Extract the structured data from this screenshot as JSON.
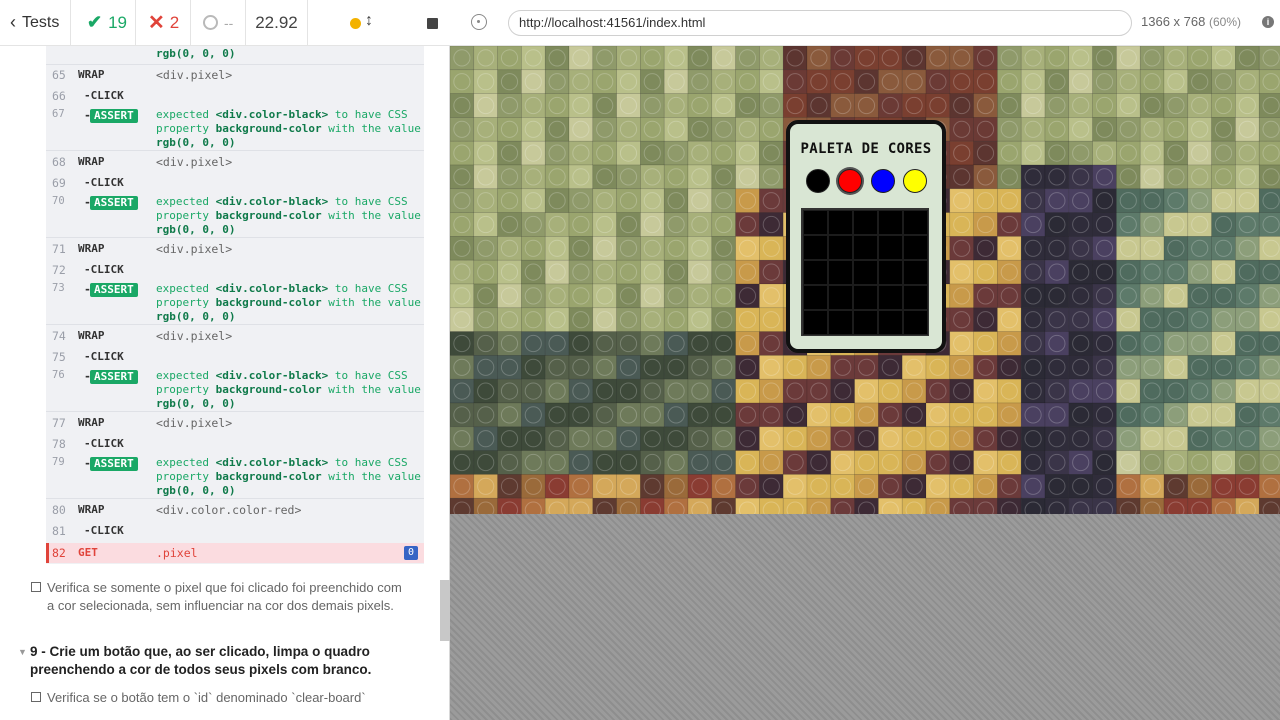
{
  "reporter": {
    "back_label": "Tests",
    "passed_count": "19",
    "failed_count": "2",
    "pending_count": "--",
    "duration": "22.92",
    "pre_text": "rgb(0, 0, 0)",
    "log": [
      {
        "n": "65",
        "cmd": "WRAP",
        "msg": "<div.pixel>"
      },
      {
        "n": "66",
        "cmd": "CLICK"
      },
      {
        "n": "67",
        "assert": "ASSERT",
        "expected": "expected",
        "sel": "<div.color-black>",
        "to_have": "to have CSS",
        "property": "property",
        "prop": "background-color",
        "with_the": "with the value",
        "value": "rgb(0, 0, 0)"
      },
      {
        "n": "68",
        "cmd": "WRAP",
        "msg": "<div.pixel>"
      },
      {
        "n": "69",
        "cmd": "CLICK"
      },
      {
        "n": "70",
        "assert": "ASSERT",
        "expected": "expected",
        "sel": "<div.color-black>",
        "to_have": "to have CSS",
        "property": "property",
        "prop": "background-color",
        "with_the": "with the value",
        "value": "rgb(0, 0, 0)"
      },
      {
        "n": "71",
        "cmd": "WRAP",
        "msg": "<div.pixel>"
      },
      {
        "n": "72",
        "cmd": "CLICK"
      },
      {
        "n": "73",
        "assert": "ASSERT",
        "expected": "expected",
        "sel": "<div.color-black>",
        "to_have": "to have CSS",
        "property": "property",
        "prop": "background-color",
        "with_the": "with the value",
        "value": "rgb(0, 0, 0)"
      },
      {
        "n": "74",
        "cmd": "WRAP",
        "msg": "<div.pixel>"
      },
      {
        "n": "75",
        "cmd": "CLICK"
      },
      {
        "n": "76",
        "assert": "ASSERT",
        "expected": "expected",
        "sel": "<div.color-black>",
        "to_have": "to have CSS",
        "property": "property",
        "prop": "background-color",
        "with_the": "with the value",
        "value": "rgb(0, 0, 0)"
      },
      {
        "n": "77",
        "cmd": "WRAP",
        "msg": "<div.pixel>"
      },
      {
        "n": "78",
        "cmd": "CLICK"
      },
      {
        "n": "79",
        "assert": "ASSERT",
        "expected": "expected",
        "sel": "<div.color-black>",
        "to_have": "to have CSS",
        "property": "property",
        "prop": "background-color",
        "with_the": "with the value",
        "value": "rgb(0, 0, 0)"
      },
      {
        "n": "80",
        "cmd": "WRAP",
        "msg": "<div.color.color-red>"
      },
      {
        "n": "81",
        "cmd": "CLICK"
      },
      {
        "n": "82",
        "cmd": "GET",
        "msg": ".pixel",
        "count": "0"
      }
    ],
    "test_pixel": "Verifica se somente o pixel que foi clicado foi preenchido com a cor selecionada, sem influenciar na cor dos demais pixels.",
    "suite_9": "9 - Crie um botão que, ao ser clicado, limpa o quadro preenchendo a cor de todos seus pixels com branco.",
    "test_clear": "Verifica se o botão tem o `id` denominado `clear-board`"
  },
  "aut": {
    "url": "http://localhost:41561/index.html",
    "viewport": "1366 x 768",
    "scale": "(60%)",
    "info_icon": "i"
  },
  "page": {
    "palette_title": "PALETA DE CORES",
    "palette_colors": [
      "#000000",
      "#ff0000",
      "#0000ff",
      "#ffff00"
    ],
    "selected_color_index": 1,
    "board_color": "#000000"
  },
  "colors": {
    "accent_pass": "#1aa866",
    "accent_fail": "#e0433a",
    "running": "#f3b200"
  }
}
